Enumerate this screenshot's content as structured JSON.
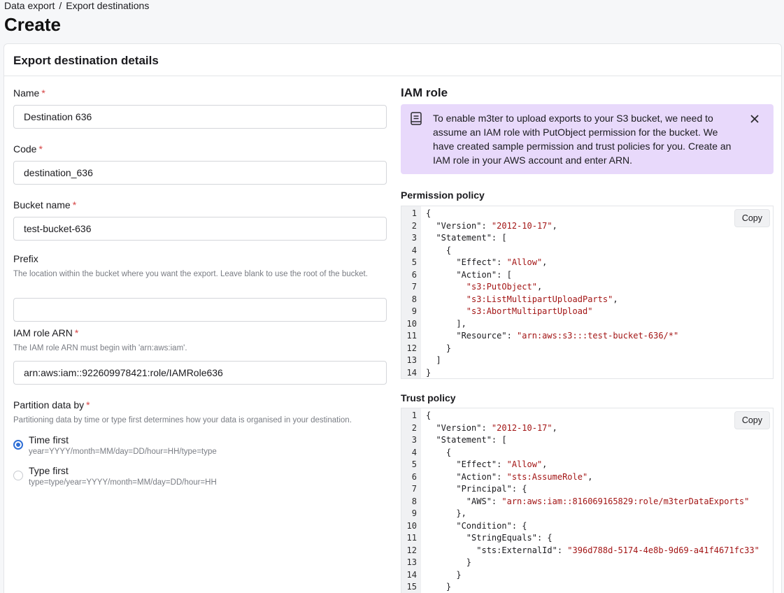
{
  "breadcrumb": {
    "root": "Data export",
    "separator": "/",
    "current": "Export destinations"
  },
  "page_title": "Create",
  "card_title": "Export destination details",
  "form": {
    "name": {
      "label": "Name",
      "value": "Destination 636"
    },
    "code": {
      "label": "Code",
      "value": "destination_636"
    },
    "bucket": {
      "label": "Bucket name",
      "value": "test-bucket-636"
    },
    "prefix": {
      "label": "Prefix",
      "helper": "The location within the bucket where you want the export. Leave blank to use the root of the bucket.",
      "value": ""
    },
    "iam_arn": {
      "label": "IAM role ARN",
      "helper": "The IAM role ARN must begin with 'arn:aws:iam'.",
      "value": "arn:aws:iam::922609978421:role/IAMRole636"
    },
    "partition": {
      "label": "Partition data by",
      "helper": "Partitioning data by time or type first determines how your data is organised in your destination.",
      "options": [
        {
          "title": "Time first",
          "sub": "year=YYYY/month=MM/day=DD/hour=HH/type=type",
          "selected": true
        },
        {
          "title": "Type first",
          "sub": "type=type/year=YYYY/month=MM/day=DD/hour=HH",
          "selected": false
        }
      ]
    },
    "required_mark": "*"
  },
  "iam": {
    "title": "IAM role",
    "alert": "To enable m3ter to upload exports to your S3 bucket, we need to assume an IAM role with PutObject permission for the bucket. We have created sample permission and trust policies for you. Create an IAM role in your AWS account and enter ARN.",
    "permission_title": "Permission policy",
    "trust_title": "Trust policy",
    "copy_label": "Copy"
  },
  "colors": {
    "accent": "#2f6fd6",
    "alert_bg": "#e8d9fb",
    "required": "#d64545",
    "string": "#a31515"
  }
}
